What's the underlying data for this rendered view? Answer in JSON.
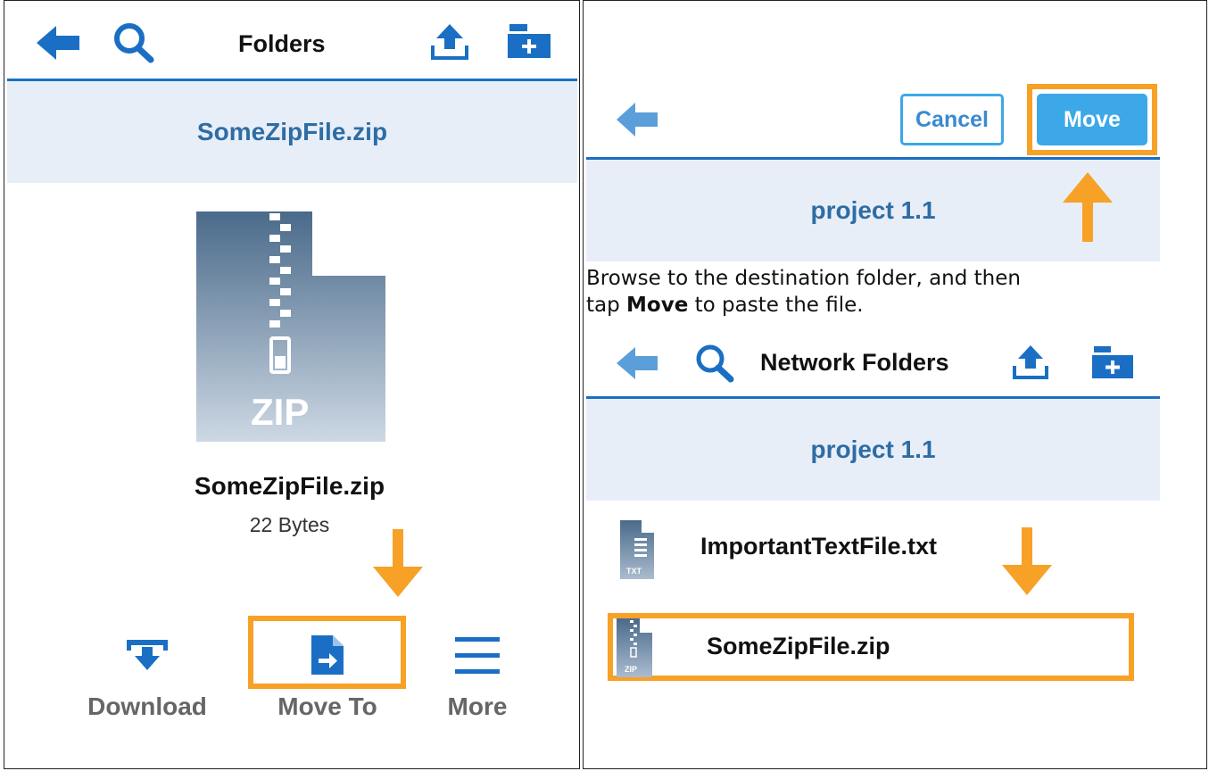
{
  "left": {
    "header": {
      "title": "Folders"
    },
    "bar_title": "SomeZipFile.zip",
    "thumbnail": {
      "label": "ZIP"
    },
    "file": {
      "name": "SomeZipFile.zip",
      "size": "22 Bytes"
    },
    "actions": [
      {
        "label": "Download",
        "icon": "download-icon"
      },
      {
        "label": "Move To",
        "icon": "move-to-icon"
      },
      {
        "label": "More",
        "icon": "menu-icon"
      }
    ]
  },
  "right": {
    "top": {
      "cancel_label": "Cancel",
      "move_label": "Move",
      "bar_title": "project 1.1"
    },
    "caption": {
      "line1": "Browse to the destination folder, and then",
      "line2_pre": "tap ",
      "line2_bold": "Move",
      "line2_post": " to paste the file."
    },
    "bottom": {
      "header_title": "Network Folders",
      "bar_title": "project 1.1",
      "files": [
        {
          "name": "ImportantTextFile.txt",
          "icon_label": "TXT"
        },
        {
          "name": "SomeZipFile.zip",
          "icon_label": "ZIP"
        }
      ]
    }
  },
  "colors": {
    "accent_blue": "#1a73c6",
    "light_blue": "#5a9fd9",
    "bar_bg": "#e8eef8",
    "highlight_orange": "#f7a127",
    "move_button": "#3da8e8"
  }
}
